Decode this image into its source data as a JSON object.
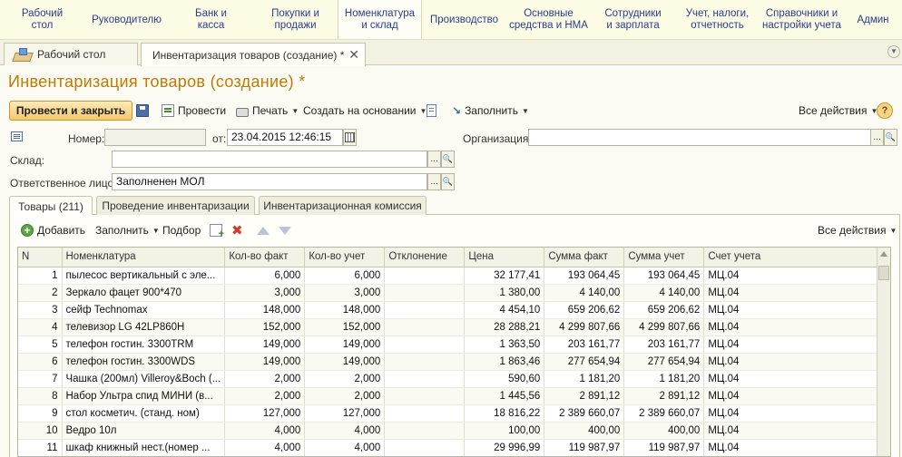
{
  "sections": [
    {
      "label": "Рабочий\nстол",
      "width": 93
    },
    {
      "label": "Руководителю",
      "width": 93
    },
    {
      "label": "Банк и\nкасса",
      "width": 93
    },
    {
      "label": "Покупки и\nпродажи",
      "width": 93
    },
    {
      "label": "Номенклатура\nи склад",
      "width": 93
    },
    {
      "label": "Производство",
      "width": 93
    },
    {
      "label": "Основные\nсредства и НМА",
      "width": 93
    },
    {
      "label": "Сотрудники\nи зарплата",
      "width": 93
    },
    {
      "label": "Учет, налоги,\nотчетность",
      "width": 93
    },
    {
      "label": "Справочники и\nнастройки учета",
      "width": 93
    },
    {
      "label": "Админ",
      "width": 64
    }
  ],
  "window_tabs": {
    "desktop": "Рабочий стол",
    "document": "Инвентаризация товаров (создание) *",
    "close": "✕"
  },
  "document": {
    "title": "Инвентаризация товаров (создание) *"
  },
  "toolbar": {
    "post_and_close": "Провести и закрыть",
    "post": "Провести",
    "print": "Печать",
    "create_based_on": "Создать на основании",
    "fill": "Заполнить",
    "all_actions": "Все действия",
    "help": "?"
  },
  "form": {
    "number_label": "Номер:",
    "number_value": "",
    "date_label": "от:",
    "date_value": "23.04.2015 12:46:15",
    "organization_label": "Организация:",
    "organization_value": "",
    "warehouse_label": "Склад:",
    "warehouse_value": "",
    "responsible_label": "Ответственное лицо:",
    "responsible_value": "Заполненен МОЛ",
    "select_btn": "...",
    "open_btn": "🔍"
  },
  "form_tabs": {
    "goods": "Товары (211)",
    "conducting": "Проведение инвентаризации",
    "commission": "Инвентаризационная комиссия"
  },
  "table_toolbar": {
    "add": "Добавить",
    "fill": "Заполнить",
    "selection": "Подбор",
    "all_actions": "Все действия"
  },
  "table": {
    "columns": [
      "N",
      "Номенклатура",
      "Кол-во факт",
      "Кол-во учет",
      "Отклонение",
      "Цена",
      "Сумма факт",
      "Сумма учет",
      "Счет учета"
    ],
    "rows": [
      [
        "1",
        "пылесос вертикальный с эле...",
        "6,000",
        "6,000",
        "",
        "32 177,41",
        "193 064,45",
        "193 064,45",
        "МЦ.04"
      ],
      [
        "2",
        "Зеркало фацет 900*470",
        "3,000",
        "3,000",
        "",
        "1 380,00",
        "4 140,00",
        "4 140,00",
        "МЦ.04"
      ],
      [
        "3",
        "сейф Technomax",
        "148,000",
        "148,000",
        "",
        "4 454,10",
        "659 206,62",
        "659 206,62",
        "МЦ.04"
      ],
      [
        "4",
        "телевизор LG 42LP860H",
        "152,000",
        "152,000",
        "",
        "28 288,21",
        "4 299 807,66",
        "4 299 807,66",
        "МЦ.04"
      ],
      [
        "5",
        "телефон гостин. 3300TRM",
        "149,000",
        "149,000",
        "",
        "1 363,50",
        "203 161,77",
        "203 161,77",
        "МЦ.04"
      ],
      [
        "6",
        "телефон гостин. 3300WDS",
        "149,000",
        "149,000",
        "",
        "1 863,46",
        "277 654,94",
        "277 654,94",
        "МЦ.04"
      ],
      [
        "7",
        "Чашка (200мл) Villeroy&Boch (...",
        "2,000",
        "2,000",
        "",
        "590,60",
        "1 181,20",
        "1 181,20",
        "МЦ.04"
      ],
      [
        "8",
        "Набор Ультра спид МИНИ (в...",
        "2,000",
        "2,000",
        "",
        "1 445,56",
        "2 891,12",
        "2 891,12",
        "МЦ.04"
      ],
      [
        "9",
        "стол косметич. (станд. ном)",
        "127,000",
        "127,000",
        "",
        "18 816,22",
        "2 389 660,07",
        "2 389 660,07",
        "МЦ.04"
      ],
      [
        "10",
        "Ведро 10л",
        "4,000",
        "4,000",
        "",
        "100,00",
        "400,00",
        "400,00",
        "МЦ.04"
      ],
      [
        "11",
        "шкаф книжный нест.(номер ...",
        "4,000",
        "4,000",
        "",
        "29 996,99",
        "119 987,97",
        "119 987,97",
        "МЦ.04"
      ]
    ]
  }
}
